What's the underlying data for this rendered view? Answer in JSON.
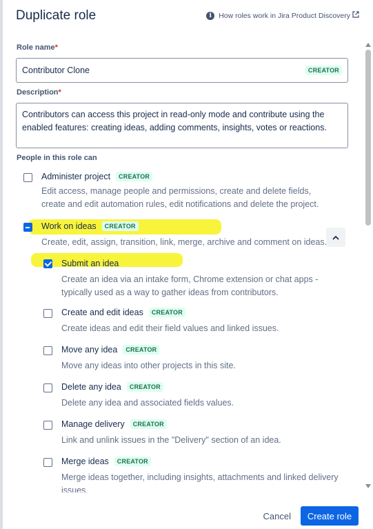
{
  "dialog": {
    "title": "Duplicate role",
    "help_link": "How roles work in Jira Product Discovery"
  },
  "role_name": {
    "label": "Role name",
    "required_mark": "*",
    "value": "Contributor Clone",
    "badge": "CREATOR"
  },
  "description": {
    "label": "Description",
    "required_mark": "*",
    "value": "Contributors can access this project in read-only mode and contribute using the enabled features: creating ideas, adding comments, insights, votes or reactions."
  },
  "people_section": {
    "label": "People in this role can"
  },
  "permissions": [
    {
      "title": "Administer project",
      "badge": "CREATOR",
      "state": "unchecked",
      "description": "Edit access, manage people and permissions, create and delete fields, create and edit automation rules, edit notifications and delete the project."
    },
    {
      "title": "Work on ideas",
      "badge": "CREATOR",
      "state": "indeterminate",
      "description": "Create, edit, assign, transition, link, merge, archive and comment on ideas."
    },
    {
      "title": "Submit an idea",
      "badge": "",
      "state": "checked",
      "description": "Create an idea via an intake form, Chrome extension or chat apps - typically used as a way to gather ideas from contributors."
    },
    {
      "title": "Create and edit ideas",
      "badge": "CREATOR",
      "state": "unchecked",
      "description": "Create ideas and edit their field values and linked issues."
    },
    {
      "title": "Move any idea",
      "badge": "CREATOR",
      "state": "unchecked",
      "description": "Move any ideas into other projects in this site."
    },
    {
      "title": "Delete any idea",
      "badge": "CREATOR",
      "state": "unchecked",
      "description": "Delete any idea and associated fields values."
    },
    {
      "title": "Manage delivery",
      "badge": "CREATOR",
      "state": "unchecked",
      "description": "Link and unlink issues in the \"Delivery\" section of an idea."
    },
    {
      "title": "Merge ideas",
      "badge": "CREATOR",
      "state": "unchecked",
      "description": "Merge ideas together, including insights, attachments and linked delivery issues."
    }
  ],
  "footer": {
    "cancel_label": "Cancel",
    "create_label": "Create role"
  },
  "colors": {
    "primary": "#0c66e4",
    "badge_bg": "#dcfff1",
    "badge_text": "#216e4e",
    "highlight": "#f7f21a"
  }
}
